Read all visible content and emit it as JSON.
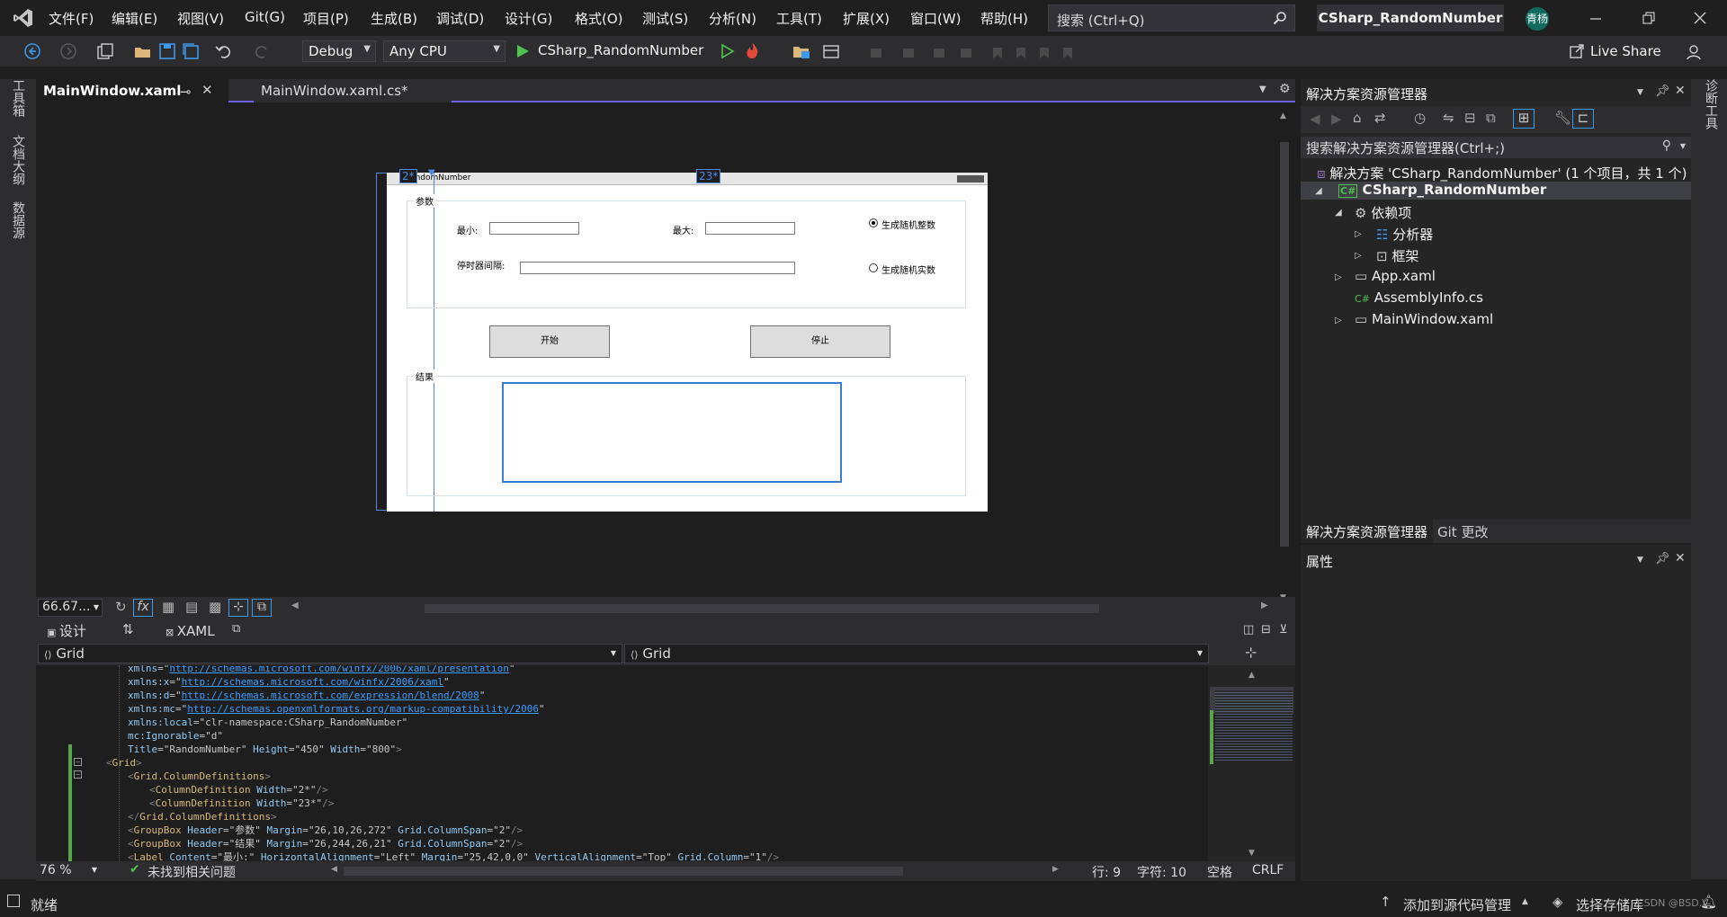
{
  "menu": [
    "文件(F)",
    "编辑(E)",
    "视图(V)",
    "Git(G)",
    "项目(P)",
    "生成(B)",
    "调试(D)",
    "设计(G)",
    "格式(O)",
    "测试(S)",
    "分析(N)",
    "工具(T)",
    "扩展(X)",
    "窗口(W)",
    "帮助(H)"
  ],
  "search": {
    "placeholder": "搜索 (Ctrl+Q)"
  },
  "solution_title": "CSharp_RandomNumber",
  "user_badge": "青杨",
  "live_share": "Live Share",
  "toolbar": {
    "config": "Debug",
    "platform": "Any CPU",
    "run_target": "CSharp_RandomNumber"
  },
  "side_tabs": [
    "工具箱",
    "文档大纲",
    "数据源"
  ],
  "right_tabs": [
    "诊断工具"
  ],
  "doc_tabs": [
    {
      "label": "MainWindow.xaml",
      "active": true
    },
    {
      "label": "MainWindow.xaml.cs*",
      "active": false
    }
  ],
  "designer": {
    "window_title": "RandomNumber",
    "col_marker_1": "2*",
    "col_marker_2": "23*",
    "group_params": "参数",
    "label_min": "最小:",
    "label_max": "最大:",
    "label_timer": "停时器间隔:",
    "radio_int": "生成随机整数",
    "radio_real": "生成随机实数",
    "btn_start": "开始",
    "btn_stop": "停止",
    "group_result": "结果"
  },
  "zoom": "66.67...",
  "split_tabs": {
    "design": "设计",
    "xaml": "XAML"
  },
  "xaml_nav": {
    "left": "Grid",
    "right": "Grid"
  },
  "code_lines": [
    [
      {
        "c": "at",
        "t": "xmlns"
      },
      {
        "c": "st",
        "t": "=\""
      },
      {
        "c": "ur",
        "t": "http://schemas.microsoft.com/winfx/2006/xaml/presentation"
      },
      {
        "c": "st",
        "t": "\""
      }
    ],
    [
      {
        "c": "at",
        "t": "xmlns:x"
      },
      {
        "c": "st",
        "t": "=\""
      },
      {
        "c": "ur",
        "t": "http://schemas.microsoft.com/winfx/2006/xaml"
      },
      {
        "c": "st",
        "t": "\""
      }
    ],
    [
      {
        "c": "at",
        "t": "xmlns:d"
      },
      {
        "c": "st",
        "t": "=\""
      },
      {
        "c": "ur",
        "t": "http://schemas.microsoft.com/expression/blend/2008"
      },
      {
        "c": "st",
        "t": "\""
      }
    ],
    [
      {
        "c": "at",
        "t": "xmlns:mc"
      },
      {
        "c": "st",
        "t": "=\""
      },
      {
        "c": "ur",
        "t": "http://schemas.openxmlformats.org/markup-compatibility/2006"
      },
      {
        "c": "st",
        "t": "\""
      }
    ],
    [
      {
        "c": "at",
        "t": "xmlns:local"
      },
      {
        "c": "st",
        "t": "=\"clr-namespace:CSharp_RandomNumber\""
      }
    ],
    [
      {
        "c": "at",
        "t": "mc:Ignorable"
      },
      {
        "c": "st",
        "t": "=\"d\""
      }
    ],
    [
      {
        "c": "at",
        "t": "Title"
      },
      {
        "c": "st",
        "t": "=\"RandomNumber\" "
      },
      {
        "c": "at",
        "t": "Height"
      },
      {
        "c": "st",
        "t": "=\"450\" "
      },
      {
        "c": "at",
        "t": "Width"
      },
      {
        "c": "st",
        "t": "=\"800\""
      },
      {
        "c": "tg",
        "t": ">"
      }
    ],
    [
      {
        "c": "tg",
        "t": "<"
      },
      {
        "c": "el",
        "t": "Grid"
      },
      {
        "c": "tg",
        "t": ">"
      }
    ],
    [
      {
        "c": "tg",
        "t": "<"
      },
      {
        "c": "el",
        "t": "Grid.ColumnDefinitions"
      },
      {
        "c": "tg",
        "t": ">"
      }
    ],
    [
      {
        "c": "tg",
        "t": "<"
      },
      {
        "c": "el",
        "t": "ColumnDefinition "
      },
      {
        "c": "at",
        "t": "Width"
      },
      {
        "c": "st",
        "t": "=\"2*\""
      },
      {
        "c": "tg",
        "t": "/>"
      }
    ],
    [
      {
        "c": "tg",
        "t": "<"
      },
      {
        "c": "el",
        "t": "ColumnDefinition "
      },
      {
        "c": "at",
        "t": "Width"
      },
      {
        "c": "st",
        "t": "=\"23*\""
      },
      {
        "c": "tg",
        "t": "/>"
      }
    ],
    [
      {
        "c": "tg",
        "t": "</"
      },
      {
        "c": "el",
        "t": "Grid.ColumnDefinitions"
      },
      {
        "c": "tg",
        "t": ">"
      }
    ],
    [
      {
        "c": "tg",
        "t": "<"
      },
      {
        "c": "el",
        "t": "GroupBox "
      },
      {
        "c": "at",
        "t": "Header"
      },
      {
        "c": "st",
        "t": "=\"参数\" "
      },
      {
        "c": "at",
        "t": "Margin"
      },
      {
        "c": "st",
        "t": "=\"26,10,26,272\" "
      },
      {
        "c": "at",
        "t": "Grid.ColumnSpan"
      },
      {
        "c": "st",
        "t": "=\"2\""
      },
      {
        "c": "tg",
        "t": "/>"
      }
    ],
    [
      {
        "c": "tg",
        "t": "<"
      },
      {
        "c": "el",
        "t": "GroupBox "
      },
      {
        "c": "at",
        "t": "Header"
      },
      {
        "c": "st",
        "t": "=\"结果\" "
      },
      {
        "c": "at",
        "t": "Margin"
      },
      {
        "c": "st",
        "t": "=\"26,244,26,21\" "
      },
      {
        "c": "at",
        "t": "Grid.ColumnSpan"
      },
      {
        "c": "st",
        "t": "=\"2\""
      },
      {
        "c": "tg",
        "t": "/>"
      }
    ],
    [
      {
        "c": "tg",
        "t": "<"
      },
      {
        "c": "el",
        "t": "Label "
      },
      {
        "c": "at",
        "t": "Content"
      },
      {
        "c": "st",
        "t": "=\"最小:\" "
      },
      {
        "c": "at",
        "t": "HorizontalAlignment"
      },
      {
        "c": "st",
        "t": "=\"Left\" "
      },
      {
        "c": "at",
        "t": "Margin"
      },
      {
        "c": "st",
        "t": "=\"25,42,0,0\" "
      },
      {
        "c": "at",
        "t": "VerticalAlignment"
      },
      {
        "c": "st",
        "t": "=\"Top\" "
      },
      {
        "c": "at",
        "t": "Grid.Column"
      },
      {
        "c": "st",
        "t": "=\"1\""
      },
      {
        "c": "tg",
        "t": "/>"
      }
    ]
  ],
  "editor_status": {
    "zoom": "76 %",
    "issues": "未找到相关问题",
    "line": "行: 9",
    "col": "字符: 10",
    "ws": "空格",
    "eol": "CRLF"
  },
  "solution_explorer": {
    "title": "解决方案资源管理器",
    "search": "搜索解决方案资源管理器(Ctrl+;)",
    "items": [
      {
        "label": "解决方案 'CSharp_RandomNumber' (1 个项目，共 1 个)"
      },
      {
        "label": "CSharp_RandomNumber"
      },
      {
        "label": "依赖项"
      },
      {
        "label": "分析器"
      },
      {
        "label": "框架"
      },
      {
        "label": "App.xaml"
      },
      {
        "label": "AssemblyInfo.cs"
      },
      {
        "label": "MainWindow.xaml"
      }
    ]
  },
  "se_tabs": [
    "解决方案资源管理器",
    "Git 更改"
  ],
  "props_title": "属性",
  "status": {
    "ready": "就绪",
    "add_source": "添加到源代码管理",
    "choose_repo": "选择存储库",
    "watermark": "CSDN @BSD.V"
  },
  "colors": {
    "accent": "#7160e8",
    "selection_blue": "#4f8ae0",
    "run_green": "#4ec24e"
  }
}
